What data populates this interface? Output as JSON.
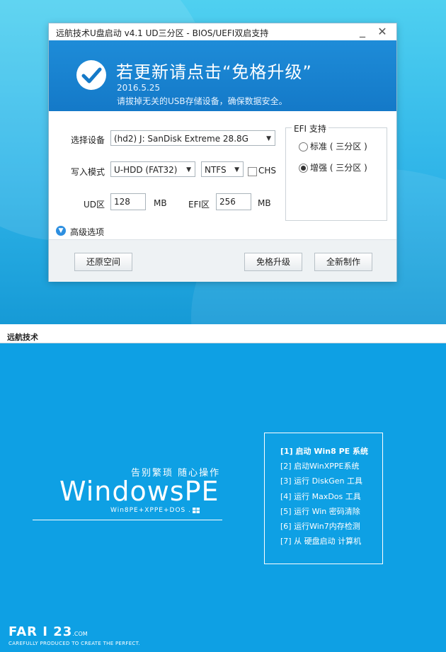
{
  "colors": {
    "banner_blue": "#1479c8",
    "desktop_blue": "#0ea0e4",
    "accent": "#2d8fe0"
  },
  "window": {
    "title": "远航技术U盘启动 v4.1 UD三分区 - BIOS/UEFI双启支持",
    "minimize_glyph": "_",
    "close_glyph": "✕"
  },
  "banner": {
    "icon": "check-circle-icon",
    "headline": "若更新请点击“免格升级”",
    "date": "2016.5.25",
    "notice": "请拔掉无关的USB存储设备，确保数据安全。"
  },
  "form": {
    "device_label": "选择设备",
    "device_value": "(hd2) J: SanDisk Extreme 28.8G",
    "mode_label": "写入模式",
    "mode_value": "U-HDD (FAT32)",
    "fs_value": "NTFS",
    "chs_label": "CHS",
    "ud_label": "UD区",
    "ud_value": "128",
    "ud_unit": "MB",
    "efi_label": "EFI区",
    "efi_value": "256",
    "efi_unit": "MB"
  },
  "efi_group": {
    "title": "EFI 支持",
    "options": [
      {
        "label": "标准 ( 三分区 )",
        "checked": false
      },
      {
        "label": "增强 ( 三分区 )",
        "checked": true
      }
    ]
  },
  "advanced": {
    "label": "高级选项",
    "icon": "chevron-down-circle-icon"
  },
  "buttons": {
    "restore": "还原空间",
    "upgrade": "免格升级",
    "new_build": "全新制作"
  },
  "pe_screen": {
    "title_bar": "远航技术",
    "slogan": "告别繁琐  随心操作",
    "logo": "WindowsPE",
    "subline": "Win8PE+XPPE+DOS .",
    "menu": [
      "[1] 启动 Win8 PE 系统",
      "[2] 启动WinXPPE系统",
      "[3] 运行 DiskGen 工具",
      "[4] 运行 MaxDos 工具",
      "[5] 运行 Win 密码清除",
      "[6] 运行Win7内存检测",
      "[7] 从 硬盘启动 计算机"
    ],
    "brand": "FAR I 23",
    "brand_suffix": ".COM",
    "brand_tagline": "CAREFULLY PRODUCED TO CREATE THE PERFECT."
  }
}
